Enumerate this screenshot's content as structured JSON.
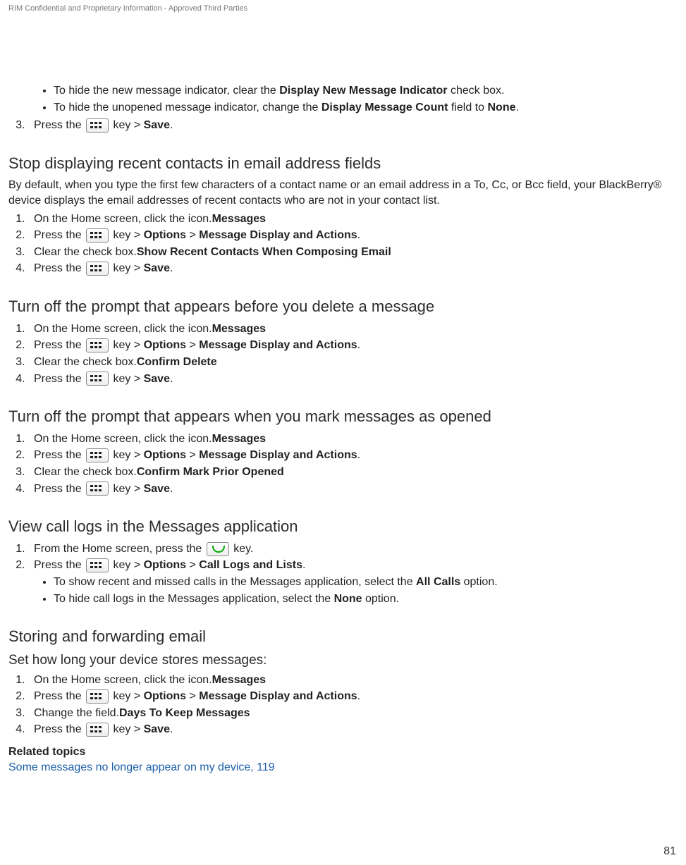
{
  "header": {
    "confidential": "RIM Confidential and Proprietary Information - Approved Third Parties"
  },
  "intro_bullets": [
    {
      "pre": "To hide the new message indicator, clear the ",
      "bold": "Display New Message Indicator",
      "post": " check box."
    },
    {
      "pre": "To hide the unopened message indicator, change the ",
      "bold": "Display Message Count",
      "post": " field to ",
      "bold2": "None",
      "post2": "."
    }
  ],
  "intro_step3": {
    "num": "3.",
    "pre": "Press the ",
    "post": " key > ",
    "bold": "Save",
    "tail": "."
  },
  "sec1": {
    "title": "Stop displaying recent contacts in email address fields",
    "intro": "By default, when you type the first few characters of a contact name or an email address in a To, Cc, or Bcc field, your BlackBerry® device displays the email addresses of recent contacts who are not in your contact list.",
    "steps": [
      {
        "pre": "On the Home screen, click the ",
        "bold": "Messages",
        "post": " icon."
      },
      {
        "pre": "Press the ",
        "key": "menu",
        "post": " key > ",
        "bold": "Options",
        "post2": " > ",
        "bold2": "Message Display and Actions",
        "tail": "."
      },
      {
        "pre": "Clear the ",
        "bold": "Show Recent Contacts When Composing Email",
        "post": " check box."
      },
      {
        "pre": "Press the ",
        "key": "menu",
        "post": " key > ",
        "bold": "Save",
        "tail": "."
      }
    ]
  },
  "sec2": {
    "title": "Turn off the prompt that appears before you delete a message",
    "steps": [
      {
        "pre": "On the Home screen, click the ",
        "bold": "Messages",
        "post": " icon."
      },
      {
        "pre": "Press the ",
        "key": "menu",
        "post": " key > ",
        "bold": "Options",
        "post2": " > ",
        "bold2": "Message Display and Actions",
        "tail": "."
      },
      {
        "pre": "Clear the ",
        "bold": "Confirm Delete",
        "post": " check box."
      },
      {
        "pre": "Press the ",
        "key": "menu",
        "post": " key > ",
        "bold": "Save",
        "tail": "."
      }
    ]
  },
  "sec3": {
    "title": "Turn off the prompt that appears when you mark messages as opened",
    "steps": [
      {
        "pre": "On the Home screen, click the ",
        "bold": "Messages",
        "post": " icon."
      },
      {
        "pre": "Press the ",
        "key": "menu",
        "post": " key > ",
        "bold": "Options",
        "post2": " > ",
        "bold2": "Message Display and Actions",
        "tail": "."
      },
      {
        "pre": "Clear the ",
        "bold": "Confirm Mark Prior Opened",
        "post": " check box."
      },
      {
        "pre": "Press the ",
        "key": "menu",
        "post": " key > ",
        "bold": "Save",
        "tail": "."
      }
    ]
  },
  "sec4": {
    "title": "View call logs in the Messages application",
    "steps": [
      {
        "pre": "From the Home screen, press the ",
        "key": "send",
        "post": " key."
      },
      {
        "pre": "Press the ",
        "key": "menu",
        "post": " key > ",
        "bold": "Options",
        "post2": " > ",
        "bold2": "Call Logs and Lists",
        "tail": "."
      }
    ],
    "bullets": [
      {
        "pre": "To show recent and missed calls in the Messages application, select the ",
        "bold": "All Calls",
        "post": " option."
      },
      {
        "pre": "To hide call logs in the Messages application, select the ",
        "bold": "None",
        "post": " option."
      }
    ]
  },
  "sec5": {
    "title": "Storing and forwarding email",
    "subtitle": "Set how long your device stores messages:",
    "steps": [
      {
        "pre": "On the Home screen, click the ",
        "bold": "Messages",
        "post": " icon."
      },
      {
        "pre": "Press the ",
        "key": "menu",
        "post": " key > ",
        "bold": "Options",
        "post2": " > ",
        "bold2": "Message Display and Actions",
        "tail": "."
      },
      {
        "pre": "Change the ",
        "bold": "Days To Keep Messages",
        "post": " field."
      },
      {
        "pre": "Press the ",
        "key": "menu",
        "post": " key > ",
        "bold": "Save",
        "tail": "."
      }
    ]
  },
  "related": {
    "heading": "Related topics",
    "link": "Some messages no longer appear on my device, 119"
  },
  "page_number": "81"
}
